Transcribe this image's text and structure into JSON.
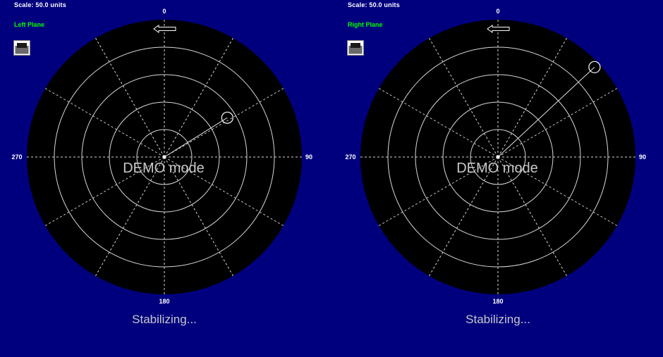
{
  "colors": {
    "background": "#00007f",
    "radar_face": "#000000",
    "grid": "#d8d8d8",
    "label_text": "#ffffff",
    "plane_label": "#00ff00",
    "status_text": "#c8c8c8"
  },
  "panels": [
    {
      "scale_text": "Scale: 50.0 units",
      "plane_label": "Left Plane",
      "icon": "device-icon",
      "direction_indicator": "left-arrow-icon",
      "bearing_labels": {
        "top": "0",
        "right": "90",
        "bottom": "180",
        "left": "270"
      },
      "mode_text": "DEMO mode",
      "status_text": "Stabilizing...",
      "target": {
        "bearing_deg": 58,
        "range_units": 27
      }
    },
    {
      "scale_text": "Scale: 50.0 units",
      "plane_label": "Right Plane",
      "icon": "device-icon",
      "direction_indicator": "left-arrow-icon",
      "bearing_labels": {
        "top": "0",
        "right": "90",
        "bottom": "180",
        "left": "270"
      },
      "mode_text": "DEMO mode",
      "status_text": "Stabilizing...",
      "target": {
        "bearing_deg": 47,
        "range_units": 48
      }
    }
  ]
}
